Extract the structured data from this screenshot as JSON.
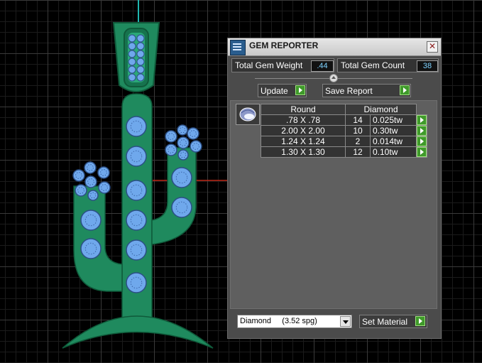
{
  "panel": {
    "title": "GEM REPORTER",
    "close": "✕",
    "total_gem_weight_label": "Total Gem Weight",
    "total_gem_weight_value": ".44",
    "total_gem_count_label": "Total Gem Count",
    "total_gem_count_value": "38",
    "update_label": "Update",
    "save_report_label": "Save Report",
    "table": {
      "headers": [
        "Round",
        "Diamond"
      ],
      "rows": [
        {
          "size": ".78 X .78",
          "count": "14",
          "weight": "0.025tw"
        },
        {
          "size": "2.00 X 2.00",
          "count": "10",
          "weight": "0.30tw"
        },
        {
          "size": "1.24 X 1.24",
          "count": "2",
          "weight": "0.014tw"
        },
        {
          "size": "1.30 X 1.30",
          "count": "12",
          "weight": "0.10tw"
        }
      ]
    },
    "material_selected": "Diamond     (3.52 spg)",
    "set_material_label": "Set Material"
  },
  "colors": {
    "model_green": "#1f8a5e",
    "gem_blue": "#6fa8ec",
    "accent_green": "#3f9a2a",
    "value_text": "#7fd2ff"
  },
  "icons": {
    "app": "gem-reporter-icon",
    "close": "close-icon",
    "arrow": "play-arrow-icon",
    "thumb": "round-gem-icon",
    "dropdown": "chevron-down-icon"
  }
}
